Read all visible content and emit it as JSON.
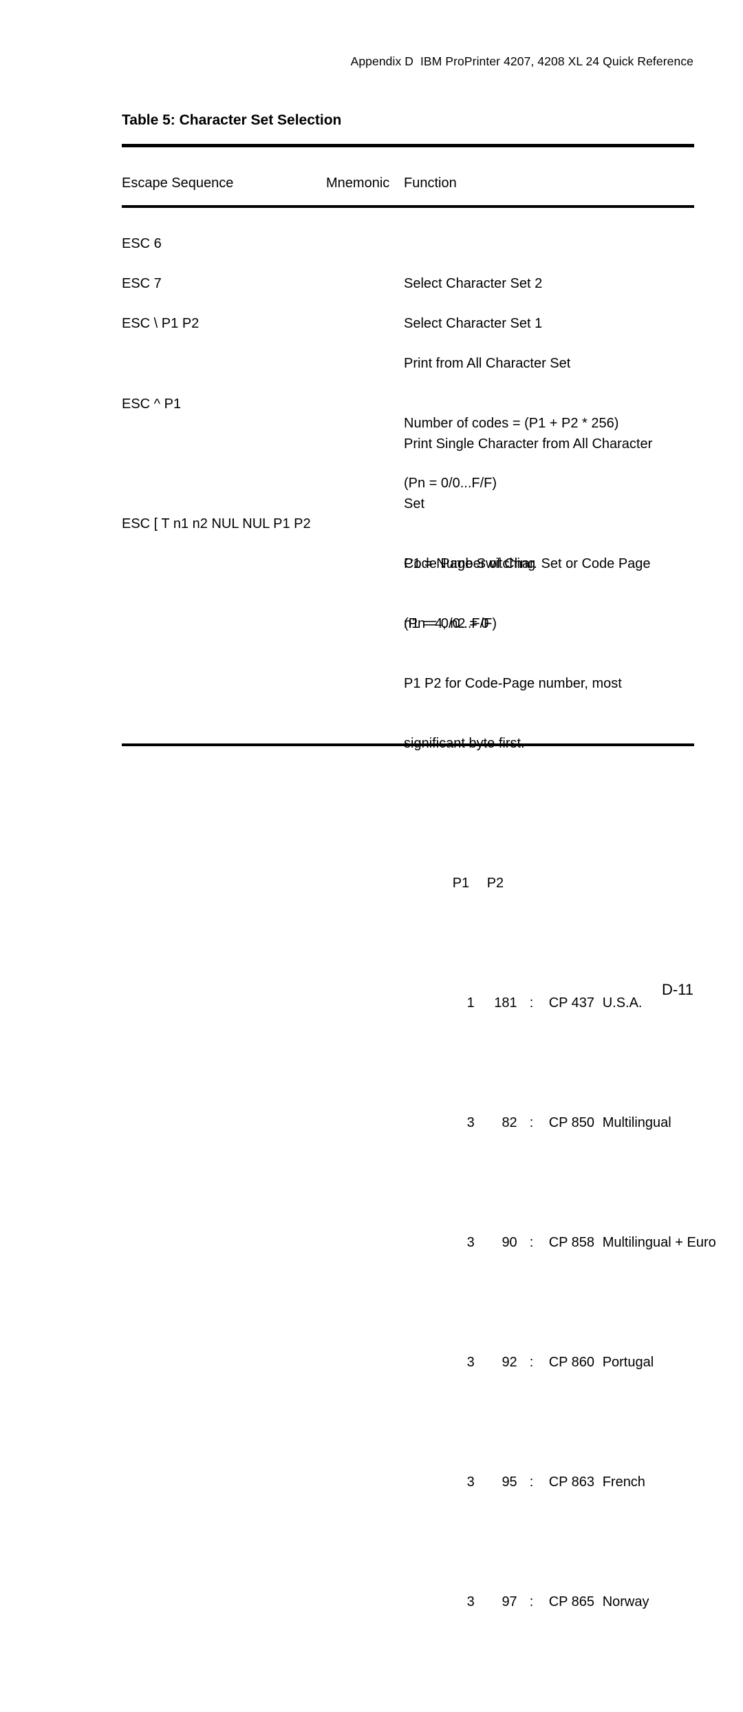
{
  "document": {
    "running_header": "Appendix D  IBM ProPrinter 4207, 4208 XL 24 Quick Reference",
    "folio": "D-11",
    "background_color": "#ffffff",
    "text_color": "#000000"
  },
  "table": {
    "title": "Table 5: Character Set Selection",
    "columns": {
      "escape_sequence": "Escape Sequence",
      "mnemonic": "Mnemonic",
      "function": "Function"
    },
    "rows": [
      {
        "escape_sequence": "ESC 6",
        "mnemonic": "",
        "function_lines": [
          "Select Character Set 2"
        ]
      },
      {
        "escape_sequence": "ESC 7",
        "mnemonic": "",
        "function_lines": [
          "Select Character Set 1"
        ]
      },
      {
        "escape_sequence": "ESC \\ P1 P2",
        "mnemonic": "",
        "function_lines": [
          "Print from All Character Set",
          "Number of codes = (P1 + P2 * 256)",
          "(Pn = 0/0...F/F)"
        ]
      },
      {
        "escape_sequence": "ESC ^ P1",
        "mnemonic": "",
        "function_lines": [
          "Print Single Character from All Character",
          "Set",
          "P1 = Number of Char. Set or Code Page",
          "(Pn = 0/0...F/F)"
        ]
      },
      {
        "escape_sequence": "ESC [ T n1 n2 NUL NUL P1 P2",
        "mnemonic": "",
        "function_lines": [
          "Code Page Switching",
          "n1 = 4, n2 = 0",
          "P1 P2 for Code-Page number, most",
          "significant byte first."
        ]
      }
    ]
  },
  "code_page_table": {
    "header": {
      "p1": "P1",
      "p2": "P2"
    },
    "rows": [
      {
        "p1": "1",
        "p2": "181",
        "colon": ":",
        "code_page": "CP 437",
        "name": "U.S.A."
      },
      {
        "p1": "3",
        "p2": "82",
        "colon": ":",
        "code_page": "CP 850",
        "name": "Multilingual"
      },
      {
        "p1": "3",
        "p2": "90",
        "colon": ":",
        "code_page": "CP 858",
        "name": "Multilingual + Euro"
      },
      {
        "p1": "3",
        "p2": "92",
        "colon": ":",
        "code_page": "CP 860",
        "name": "Portugal"
      },
      {
        "p1": "3",
        "p2": "95",
        "colon": ":",
        "code_page": "CP 863",
        "name": "French"
      },
      {
        "p1": "3",
        "p2": "97",
        "colon": ":",
        "code_page": "CP 865",
        "name": "Norway"
      }
    ]
  }
}
